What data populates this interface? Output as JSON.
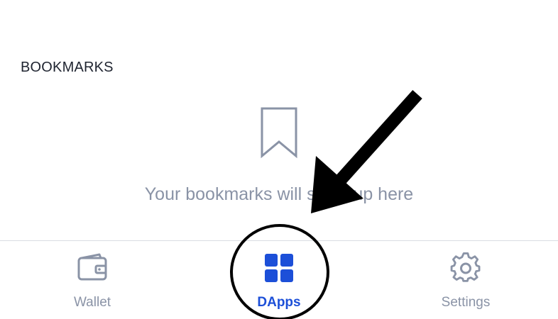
{
  "bookmarks": {
    "section_title": "BOOKMARKS",
    "empty_message": "Your bookmarks will show up here"
  },
  "tabbar": {
    "active_tab": "DApps",
    "tabs": [
      {
        "label": "Wallet",
        "icon": "wallet-icon"
      },
      {
        "label": "DApps",
        "icon": "grid-icon"
      },
      {
        "label": "Settings",
        "icon": "gear-icon"
      }
    ]
  },
  "colors": {
    "accent": "#1c4fd8",
    "inactive": "#8a93a6",
    "title": "#1f2430",
    "annotation": "#000000"
  },
  "annotation": {
    "arrow_icon": "arrow-icon",
    "highlight_icon": "circle-highlight-icon"
  }
}
